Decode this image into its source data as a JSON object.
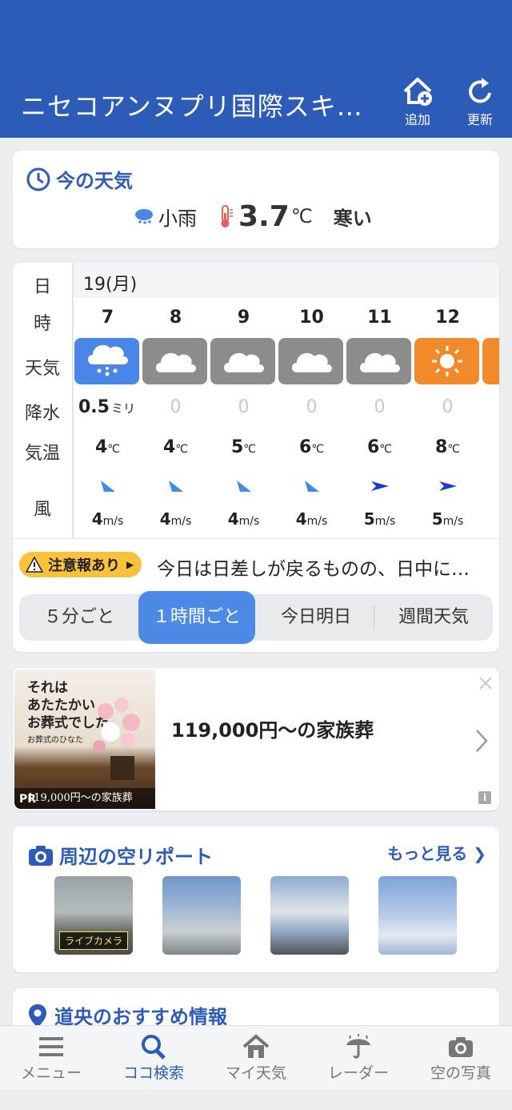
{
  "header": {
    "title": "ニセコアンヌプリ国際スキ…",
    "add_label": "追加",
    "refresh_label": "更新"
  },
  "current": {
    "heading": "今の天気",
    "condition": "小雨",
    "temp": "3.7",
    "temp_unit": "℃",
    "feel": "寒い"
  },
  "hourly": {
    "row_labels": {
      "day": "日",
      "hour": "時",
      "weather": "天気",
      "precip": "降水",
      "temp": "気温",
      "wind": "風"
    },
    "date": "19(月)",
    "hours": [
      {
        "hour": "7",
        "icon": "light-rain-icon",
        "precip": "0.5",
        "precip_unit": "ミリ",
        "temp": "4",
        "wind_speed": "4",
        "wind_color": "#3a8ee6"
      },
      {
        "hour": "8",
        "icon": "cloudy-icon",
        "precip": "0",
        "temp": "4",
        "wind_speed": "4",
        "wind_color": "#3a8ee6"
      },
      {
        "hour": "9",
        "icon": "cloudy-icon",
        "precip": "0",
        "temp": "5",
        "wind_speed": "4",
        "wind_color": "#3a8ee6"
      },
      {
        "hour": "10",
        "icon": "cloudy-icon",
        "precip": "0",
        "temp": "6",
        "wind_speed": "4",
        "wind_color": "#3a8ee6"
      },
      {
        "hour": "11",
        "icon": "cloudy-icon",
        "precip": "0",
        "temp": "6",
        "wind_speed": "5",
        "wind_color": "#1a3ccf"
      },
      {
        "hour": "12",
        "icon": "sunny-icon",
        "precip": "0",
        "temp": "8",
        "wind_speed": "5",
        "wind_color": "#1a3ccf"
      }
    ],
    "temp_unit": "℃",
    "wind_unit": "m/s"
  },
  "alert": {
    "badge": "注意報あり",
    "text": "今日は日差しが戻るものの、日中に…"
  },
  "tabs": [
    {
      "label": "５分ごと"
    },
    {
      "label": "１時間ごと"
    },
    {
      "label": "今日明日"
    },
    {
      "label": "週間天気"
    }
  ],
  "ad": {
    "text": "119,000円〜の家族葬",
    "img_line1": "それは",
    "img_line2": "あたたかい",
    "img_line3": "お葬式でした。",
    "img_brand": "お葬式のひなた",
    "img_caption": "119,000円～の家族葬",
    "pr": "PR"
  },
  "sky": {
    "heading": "周辺の空リポート",
    "more": "もっと見る",
    "live_label": "ライブカメラ"
  },
  "next": {
    "heading": "道央のおすすめ情報"
  },
  "nav": [
    {
      "label": "メニュー",
      "icon": "menu-icon"
    },
    {
      "label": "ココ検索",
      "icon": "search-icon"
    },
    {
      "label": "マイ天気",
      "icon": "home-icon"
    },
    {
      "label": "レーダー",
      "icon": "radar-umbrella-icon"
    },
    {
      "label": "空の写真",
      "icon": "camera-icon"
    }
  ],
  "colors": {
    "brand": "#2d5cb8",
    "rain_bg": "#4a86e8",
    "cloud_bg": "#8c8c8c",
    "sun_bg": "#f08a2a",
    "alert": "#f8c23a",
    "tab_active": "#4d8ae8"
  }
}
